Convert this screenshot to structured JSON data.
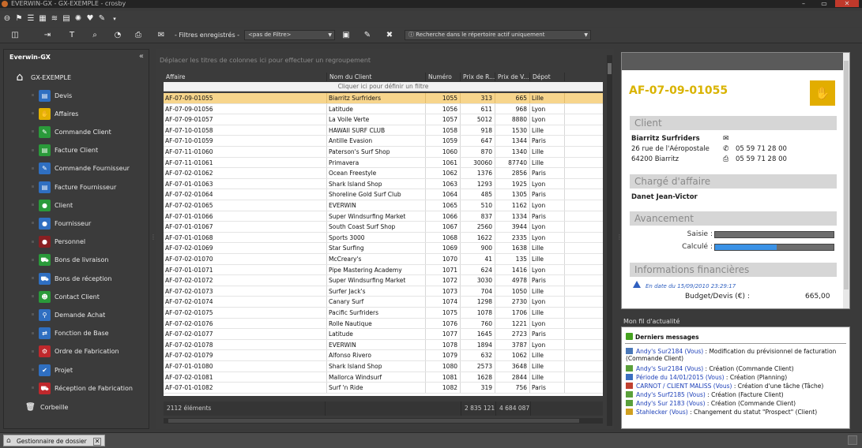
{
  "window": {
    "title": "EVERWIN-GX - GX-EXEMPLE - crosby"
  },
  "toolbar": {
    "filters_label": "- Filtres enregistrés -",
    "filter_value": "<pas de Filtre>",
    "search_scope": "Recherche dans le répertoire actif uniquement"
  },
  "sidebar": {
    "title": "Everwin-GX",
    "root": "GX-EXEMPLE",
    "items": [
      {
        "label": "Devis",
        "color": "#2f6fc1",
        "icon": "document-icon"
      },
      {
        "label": "Affaires",
        "color": "#e3b100",
        "icon": "handshake-icon"
      },
      {
        "label": "Commande Client",
        "color": "#2a9a3a",
        "icon": "order-icon"
      },
      {
        "label": "Facture Client",
        "color": "#2a9a3a",
        "icon": "invoice-icon"
      },
      {
        "label": "Commande Fournisseur",
        "color": "#2f6fc1",
        "icon": "order-icon"
      },
      {
        "label": "Facture Fournisseur",
        "color": "#2f6fc1",
        "icon": "invoice-icon"
      },
      {
        "label": "Client",
        "color": "#2a9a3a",
        "icon": "person-icon"
      },
      {
        "label": "Fournisseur",
        "color": "#2f6fc1",
        "icon": "person-icon"
      },
      {
        "label": "Personnel",
        "color": "#8a1f22",
        "icon": "person-icon"
      },
      {
        "label": "Bons de livraison",
        "color": "#2a9a3a",
        "icon": "cart-icon"
      },
      {
        "label": "Bons de réception",
        "color": "#2f6fc1",
        "icon": "cart-icon"
      },
      {
        "label": "Contact Client",
        "color": "#2a9a3a",
        "icon": "people-icon"
      },
      {
        "label": "Demande Achat",
        "color": "#2f6fc1",
        "icon": "pin-icon"
      },
      {
        "label": "Fonction de Base",
        "color": "#2f6fc1",
        "icon": "arrows-icon"
      },
      {
        "label": "Ordre de Fabrication",
        "color": "#c0282c",
        "icon": "gear-icon"
      },
      {
        "label": "Projet",
        "color": "#2f6fc1",
        "icon": "thumbs-up-icon"
      },
      {
        "label": "Réception de Fabrication",
        "color": "#c0282c",
        "icon": "cart-icon"
      }
    ],
    "trash": "Corbeille"
  },
  "grid": {
    "group_hint": "Déplacer les titres de colonnes ici pour effectuer un regroupement",
    "filter_hint": "Cliquer ici pour définir un filtre",
    "columns": [
      "Affaire",
      "Nom du Client",
      "Numéro",
      "Prix de R...",
      "Prix de V...",
      "Dépot"
    ],
    "rows": [
      [
        "AF-07-09-01055",
        "Biarritz Surfriders",
        "1055",
        "313",
        "665",
        "Lille"
      ],
      [
        "AF-07-09-01056",
        "Latitude",
        "1056",
        "611",
        "968",
        "Lyon"
      ],
      [
        "AF-07-09-01057",
        "La Voile Verte",
        "1057",
        "5012",
        "8880",
        "Lyon"
      ],
      [
        "AF-07-10-01058",
        "HAWAII SURF CLUB",
        "1058",
        "918",
        "1530",
        "Lille"
      ],
      [
        "AF-07-10-01059",
        "Antille Evasion",
        "1059",
        "647",
        "1344",
        "Paris"
      ],
      [
        "AF-07-11-01060",
        "Paterson's Surf Shop",
        "1060",
        "870",
        "1340",
        "Lille"
      ],
      [
        "AF-07-11-01061",
        "Primavera",
        "1061",
        "30060",
        "87740",
        "Lille"
      ],
      [
        "AF-07-02-01062",
        "Ocean Freestyle",
        "1062",
        "1376",
        "2856",
        "Paris"
      ],
      [
        "AF-07-01-01063",
        "Shark Island Shop",
        "1063",
        "1293",
        "1925",
        "Lyon"
      ],
      [
        "AF-07-02-01064",
        "Shoreline Gold Surf Club",
        "1064",
        "485",
        "1305",
        "Paris"
      ],
      [
        "AF-07-02-01065",
        "EVERWIN",
        "1065",
        "510",
        "1162",
        "Lyon"
      ],
      [
        "AF-07-01-01066",
        "Super Windsurfing Market",
        "1066",
        "837",
        "1334",
        "Paris"
      ],
      [
        "AF-07-01-01067",
        "South Coast Surf Shop",
        "1067",
        "2560",
        "3944",
        "Lyon"
      ],
      [
        "AF-07-01-01068",
        "Sports 3000",
        "1068",
        "1622",
        "2335",
        "Lyon"
      ],
      [
        "AF-07-02-01069",
        "Star Surfing",
        "1069",
        "900",
        "1638",
        "Lille"
      ],
      [
        "AF-07-02-01070",
        "McCreary's",
        "1070",
        "41",
        "135",
        "Lille"
      ],
      [
        "AF-07-01-01071",
        "Pipe Mastering Academy",
        "1071",
        "624",
        "1416",
        "Lyon"
      ],
      [
        "AF-07-02-01072",
        "Super Windsurfing Market",
        "1072",
        "3030",
        "4978",
        "Paris"
      ],
      [
        "AF-07-02-01073",
        "Surfer Jack's",
        "1073",
        "704",
        "1050",
        "Lille"
      ],
      [
        "AF-07-02-01074",
        "Canary Surf",
        "1074",
        "1298",
        "2730",
        "Lyon"
      ],
      [
        "AF-07-02-01075",
        "Pacific Surfriders",
        "1075",
        "1078",
        "1706",
        "Lille"
      ],
      [
        "AF-07-02-01076",
        "Rolle Nautique",
        "1076",
        "760",
        "1221",
        "Lyon"
      ],
      [
        "AF-07-02-01077",
        "Latitude",
        "1077",
        "1645",
        "2723",
        "Paris"
      ],
      [
        "AF-07-02-01078",
        "EVERWIN",
        "1078",
        "1894",
        "3787",
        "Lyon"
      ],
      [
        "AF-07-02-01079",
        "Alfonso Rivero",
        "1079",
        "632",
        "1062",
        "Lille"
      ],
      [
        "AF-07-01-01080",
        "Shark Island Shop",
        "1080",
        "2573",
        "3648",
        "Lille"
      ],
      [
        "AF-07-02-01081",
        "Mallorca Windsurf",
        "1081",
        "1628",
        "2844",
        "Lille"
      ],
      [
        "AF-07-01-01082",
        "Surf 'n Ride",
        "1082",
        "319",
        "756",
        "Paris"
      ]
    ],
    "footer": {
      "count": "2112 éléments",
      "sum_cost": "2 835 121",
      "sum_sale": "4 684 087"
    }
  },
  "detail": {
    "title": "AF-07-09-01055",
    "client_section": "Client",
    "client_name": "Biarritz Surfriders",
    "address1": "26 rue de l'Aéropostale",
    "address2": "64200 Biarritz",
    "phone": "05 59 71 28 00",
    "fax": "05 59 71 28 00",
    "manager_section": "Chargé d'affaire",
    "manager": "Danet Jean-Victor",
    "progress_section": "Avancement",
    "saisie_label": "Saisie :",
    "calcule_label": "Calculé :",
    "saisie_value": 0,
    "calcule_value": 0.52,
    "finance_section": "Informations financières",
    "finance_note": "En date du 15/09/2010 23:29:17",
    "budget_label": "Budget/Devis (€) :",
    "budget_value": "665,00"
  },
  "feed": {
    "title": "Mon fil d'actualité",
    "header": "Derniers messages",
    "items": [
      {
        "who": "Andy's Sur2184 (Vous)",
        "text": " : Modification du prévisionnel de facturation (Commande Client)"
      },
      {
        "who": "Andy's Sur2184 (Vous)",
        "text": " : Création (Commande Client)"
      },
      {
        "who": "Période du 14/01/2015 (Vous)",
        "text": " : Création (Planning)"
      },
      {
        "who": "CARNOT / CLIENT MALISS (Vous)",
        "text": " : Création d'une tâche (Tâche)"
      },
      {
        "who": "Andy's Surf2185 (Vous)",
        "text": " : Création (Facture Client)"
      },
      {
        "who": "Andy's Sur 2183 (Vous)",
        "text": " : Création (Commande Client)"
      },
      {
        "who": "Stahlecker (Vous)",
        "text": " : Changement du statut \"Prospect\" (Client)"
      }
    ]
  },
  "taskbar": {
    "tab": "Gestionnaire de dossier"
  }
}
